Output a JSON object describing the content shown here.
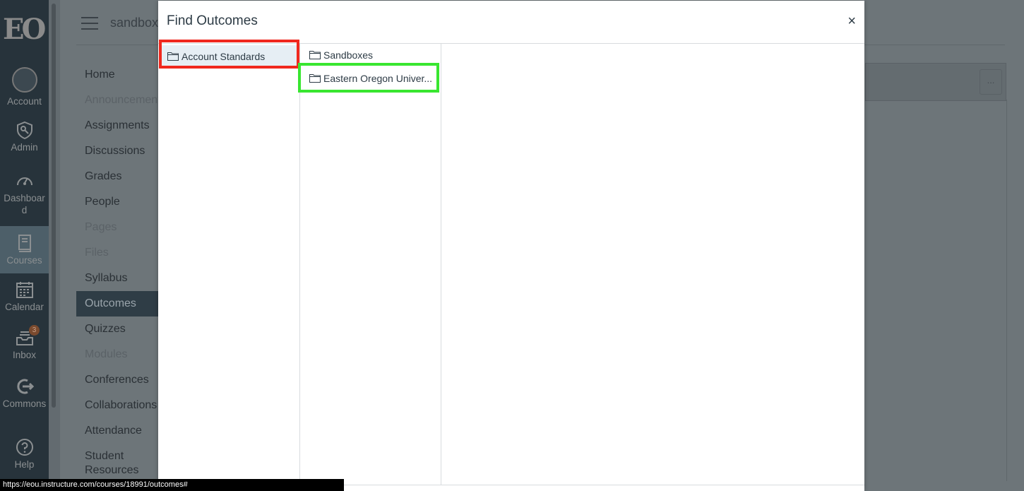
{
  "global_nav": {
    "logo": "EO",
    "items": [
      {
        "label": "Account",
        "icon": "account-avatar"
      },
      {
        "label": "Admin",
        "icon": "shield-key-icon"
      },
      {
        "label": "Dashboard",
        "icon": "dashboard-gauge-icon"
      },
      {
        "label": "Courses",
        "icon": "book-icon"
      },
      {
        "label": "Calendar",
        "icon": "calendar-icon"
      },
      {
        "label": "Inbox",
        "icon": "inbox-icon",
        "badge": "3"
      },
      {
        "label": "Commons",
        "icon": "commons-arrow-icon"
      },
      {
        "label": "Help",
        "icon": "help-icon"
      }
    ]
  },
  "course": {
    "breadcrumb": "sandbox",
    "nav": [
      {
        "label": "Home"
      },
      {
        "label": "Announcements"
      },
      {
        "label": "Assignments"
      },
      {
        "label": "Discussions"
      },
      {
        "label": "Grades"
      },
      {
        "label": "People"
      },
      {
        "label": "Pages"
      },
      {
        "label": "Files"
      },
      {
        "label": "Syllabus"
      },
      {
        "label": "Outcomes"
      },
      {
        "label": "Quizzes"
      },
      {
        "label": "Modules"
      },
      {
        "label": "Conferences"
      },
      {
        "label": "Collaborations"
      },
      {
        "label": "Attendance"
      },
      {
        "label": "Student Resources"
      }
    ],
    "more_button": "..."
  },
  "modal": {
    "title": "Find Outcomes",
    "close": "×",
    "column1": [
      {
        "label": "Account Standards",
        "selected": true
      }
    ],
    "column2": [
      {
        "label": "Sandboxes"
      },
      {
        "label": "Eastern Oregon Univer..."
      }
    ]
  },
  "status_url": "https://eou.instructure.com/courses/18991/outcomes#",
  "colors": {
    "highlight_red": "#f0281e",
    "highlight_green": "#39e630",
    "nav_bg": "#27333b"
  }
}
